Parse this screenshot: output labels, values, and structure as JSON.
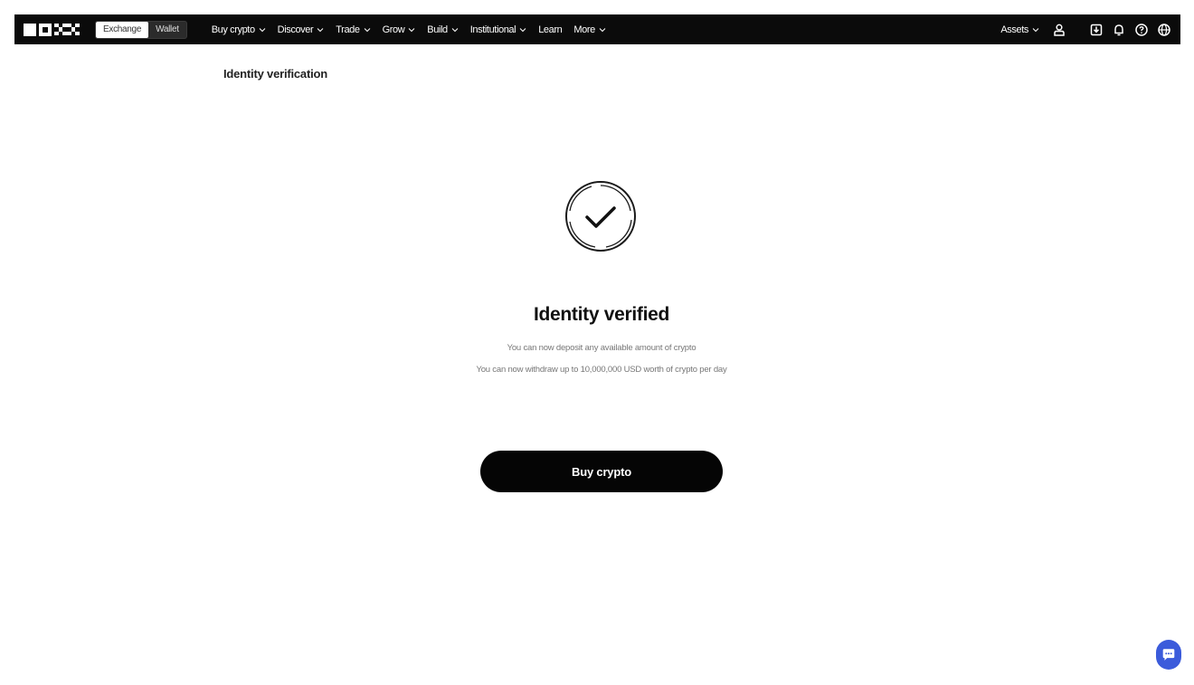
{
  "nav": {
    "switch": {
      "exchange": "Exchange",
      "wallet": "Wallet"
    },
    "menu": [
      {
        "label": "Buy crypto"
      },
      {
        "label": "Discover"
      },
      {
        "label": "Trade"
      },
      {
        "label": "Grow"
      },
      {
        "label": "Build"
      },
      {
        "label": "Institutional"
      },
      {
        "label": "Learn"
      },
      {
        "label": "More"
      }
    ],
    "assets": "Assets",
    "icons": [
      "user-icon",
      "download-icon",
      "bell-icon",
      "help-icon",
      "globe-icon"
    ]
  },
  "page": {
    "heading": "Identity verification",
    "title": "Identity verified",
    "line1": "You can now deposit any available amount of crypto",
    "line2": "You can now withdraw up to 10,000,000 USD worth of crypto per day",
    "button": "Buy crypto"
  },
  "colors": {
    "nav_bg": "#0b0b0b",
    "button_bg": "#050505",
    "chat_accent": "#3b5bdb"
  }
}
